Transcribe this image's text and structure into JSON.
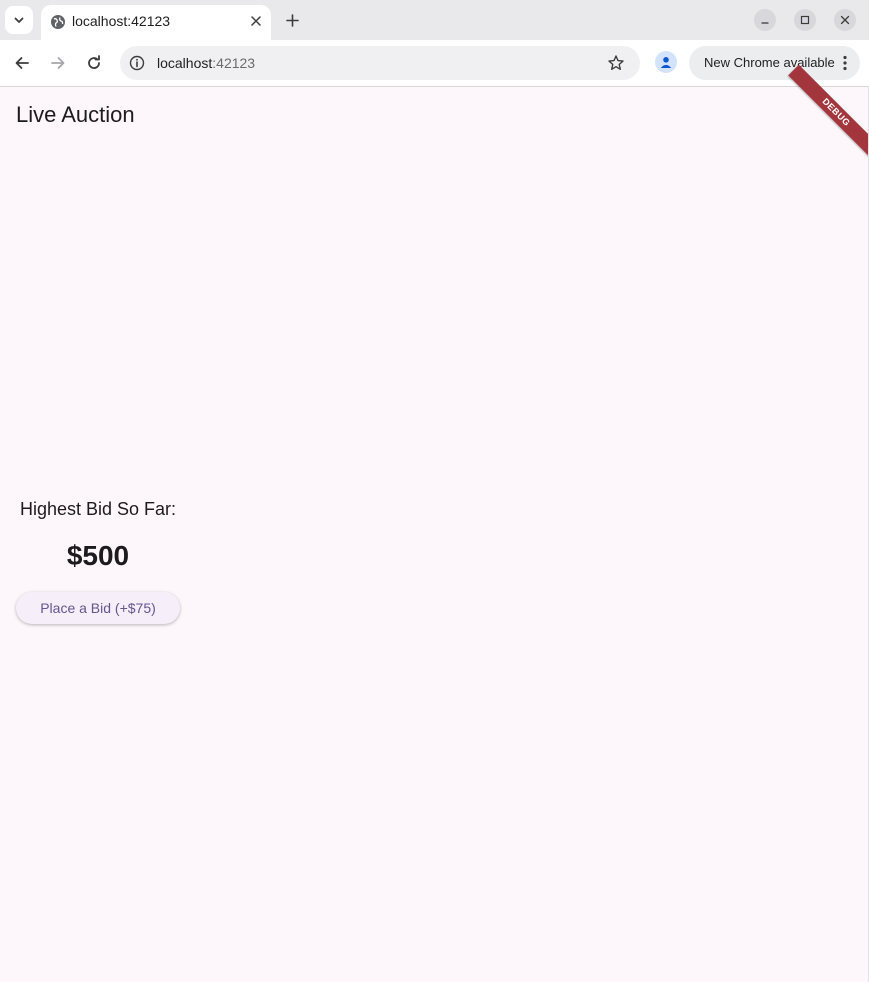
{
  "browser": {
    "tab_title": "localhost:42123",
    "url_host": "localhost",
    "url_port": ":42123",
    "update_label": "New Chrome available",
    "icons": {
      "tab_search": "chevron-down-icon",
      "favicon": "globe-icon",
      "tab_close": "close-icon",
      "new_tab": "plus-icon",
      "back": "back-arrow-icon",
      "forward": "forward-arrow-icon",
      "reload": "reload-icon",
      "site_info": "info-icon",
      "bookmark": "star-icon",
      "profile": "profile-icon",
      "menu": "kebab-menu-icon"
    }
  },
  "app": {
    "title": "Live Auction",
    "debug_banner": "DEBUG",
    "bid_label": "Highest Bid So Far:",
    "bid_amount": "$500",
    "bid_button_label": "Place a Bid (+$75)"
  },
  "colors": {
    "page_background": "#fdf7fb",
    "button_background": "#f6eff9",
    "button_text": "#65558f",
    "debug_banner": "#a3363d"
  }
}
